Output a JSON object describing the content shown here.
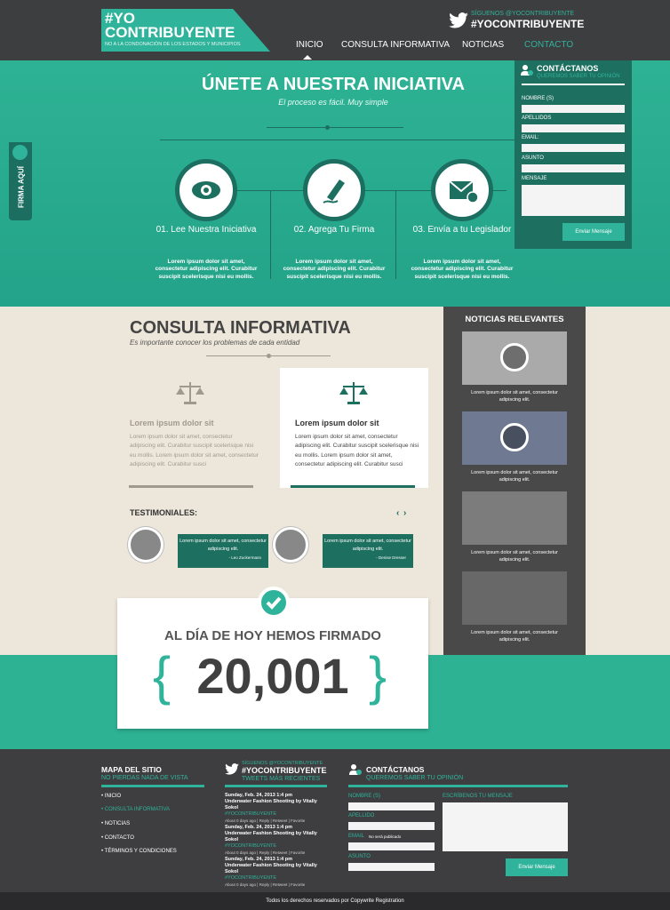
{
  "header": {
    "logo_line1": "#YO",
    "logo_line2": "CONTRIBUYENTE",
    "logo_tagline": "NO A LA CONDONACIÓN DE LOS ESTADOS Y MUNICIPIOS",
    "twitter_follow": "SÍGUENOS @YOCONTRIBUYENTE",
    "twitter_hashtag": "#YOCONTRIBUYENTE",
    "nav": [
      "INICIO",
      "CONSULTA INFORMATIVA",
      "NOTICIAS",
      "CONTACTO"
    ]
  },
  "hero": {
    "title": "ÚNETE A NUESTRA INICIATIVA",
    "subtitle": "El proceso es fácil. Muy simple",
    "side_tab": "FIRMA AQUÍ",
    "steps": [
      {
        "title": "01. Lee Nuestra Iniciativa",
        "text": "Lorem ipsum dolor sit amet, consectetur adipiscing elit. Curabitur suscipit scelerisque nisi eu mollis.",
        "icon": "eye-icon"
      },
      {
        "title": "02. Agrega Tu Firma",
        "text": "Lorem ipsum dolor sit amet, consectetur adipiscing elit. Curabitur suscipit scelerisque nisi eu mollis.",
        "icon": "pen-icon"
      },
      {
        "title": "03. Envía a tu Legislador",
        "text": "Lorem ipsum dolor sit amet, consectetur adipiscing elit. Curabitur suscipit scelerisque nisi eu mollis.",
        "icon": "envelope-icon"
      }
    ]
  },
  "contact_box": {
    "title": "CONTÁCTANOS",
    "subtitle": "QUEREMOS SABER TU OPINIÓN",
    "fields": [
      "NOMBRE (S)",
      "APELLIDOS",
      "EMAIL:",
      "ASUNTO",
      "MENSAJE"
    ],
    "send": "Enviar Mensaje"
  },
  "consulta": {
    "title": "CONSULTA INFORMATIVA",
    "subtitle": "Es importante conocer los problemas de cada entidad",
    "cards": [
      {
        "title": "Lorem ipsum dolor sit",
        "text": "Lorem ipsum dolor sit amet, consectetur adipiscing elit. Curabitur suscipit scelerisque nisi eu mollis. Lorem ipsum dolor sit amet, consectetur adipiscing elit. Curabitur susci"
      },
      {
        "title": "Lorem ipsum dolor sit",
        "text": "Lorem ipsum dolor sit amet, consectetur adipiscing elit. Curabitur suscipit scelerisque nisi eu mollis. Lorem ipsum dolor sit amet, consectetur adipiscing elit. Curabitur susci"
      }
    ]
  },
  "testimonials": {
    "title": "TESTIMONIALES:",
    "items": [
      {
        "text": "Lorem ipsum dolor sit amet, consectetur adipiscing elit.",
        "author": "- Leo Zuckermann"
      },
      {
        "text": "Lorem ipsum dolor sit amet, consectetur adipiscing elit.",
        "author": "- Denise Dresser"
      }
    ]
  },
  "counter": {
    "title": "AL DÍA DE HOY HEMOS FIRMADO",
    "number": "20,001",
    "brace_open": "{",
    "brace_close": "}"
  },
  "news": {
    "title": "NOTICIAS RELEVANTES",
    "items": [
      {
        "text": "Lorem ipsum dolor sit amet, consectetur adipiscing elit."
      },
      {
        "text": "Lorem ipsum dolor sit amet, consectetur adipiscing elit."
      },
      {
        "text": "Lorem ipsum dolor sit amet, consectetur adipiscing elit."
      },
      {
        "text": "Lorem ipsum dolor sit amet, consectetur adipiscing elit."
      }
    ]
  },
  "footer": {
    "sitemap_title": "MAPA DEL SITIO",
    "sitemap_sub": "NO PIERDAS NADA DE VISTA",
    "sitemap_links": [
      "INICIO",
      "CONSULTA INFORMATIVA",
      "NOTICIAS",
      "CONTACTO",
      "TÉRMINOS Y CONDICIONES"
    ],
    "tw_follow": "SÍGUENOS @YOCONTRIBUYENTE",
    "tw_hashtag": "#YOCONTRIBUYENTE",
    "tw_sub": "TWEETS MÁS RECIENTES",
    "tweets": [
      {
        "date": "Sunday, Feb. 24, 2013 1:4 pm",
        "text": "Underwater Fashion Shooting by Vitally Sokol",
        "tag": "#YOCONTRIBUYENTE",
        "meta": "About 0 days ago | Reply | Retweet | Favorite"
      },
      {
        "date": "Sunday, Feb. 24, 2013 1:4 pm",
        "text": "Underwater Fashion Shooting by Vitally Sokol",
        "tag": "#YOCONTRIBUYENTE",
        "meta": "About 0 days ago | Reply | Retweet | Favorite"
      },
      {
        "date": "Sunday, Feb. 24, 2013 1:4 pm",
        "text": "Underwater Fashion Shooting by Vitally Sokol",
        "tag": "#YOCONTRIBUYENTE",
        "meta": "About 0 days ago | Reply | Retweet | Favorite"
      }
    ],
    "contact_title": "CONTÁCTANOS",
    "contact_sub": "QUEREMOS SABER TU OPINIÓN",
    "fields": [
      "NOMBRE (S)",
      "APELLIDO",
      "EMAIL",
      "ASUNTO"
    ],
    "email_note": "No será publicado",
    "message_label": "ESCRÍBENOS TU MENSAJE",
    "send": "Enviar Mensaje",
    "copyright": "Todos los derechos reservados por Copywrite Registration"
  },
  "colors": {
    "accent": "#2fb39b",
    "dark_teal": "#1d6f60",
    "dark": "#3e3e40"
  }
}
